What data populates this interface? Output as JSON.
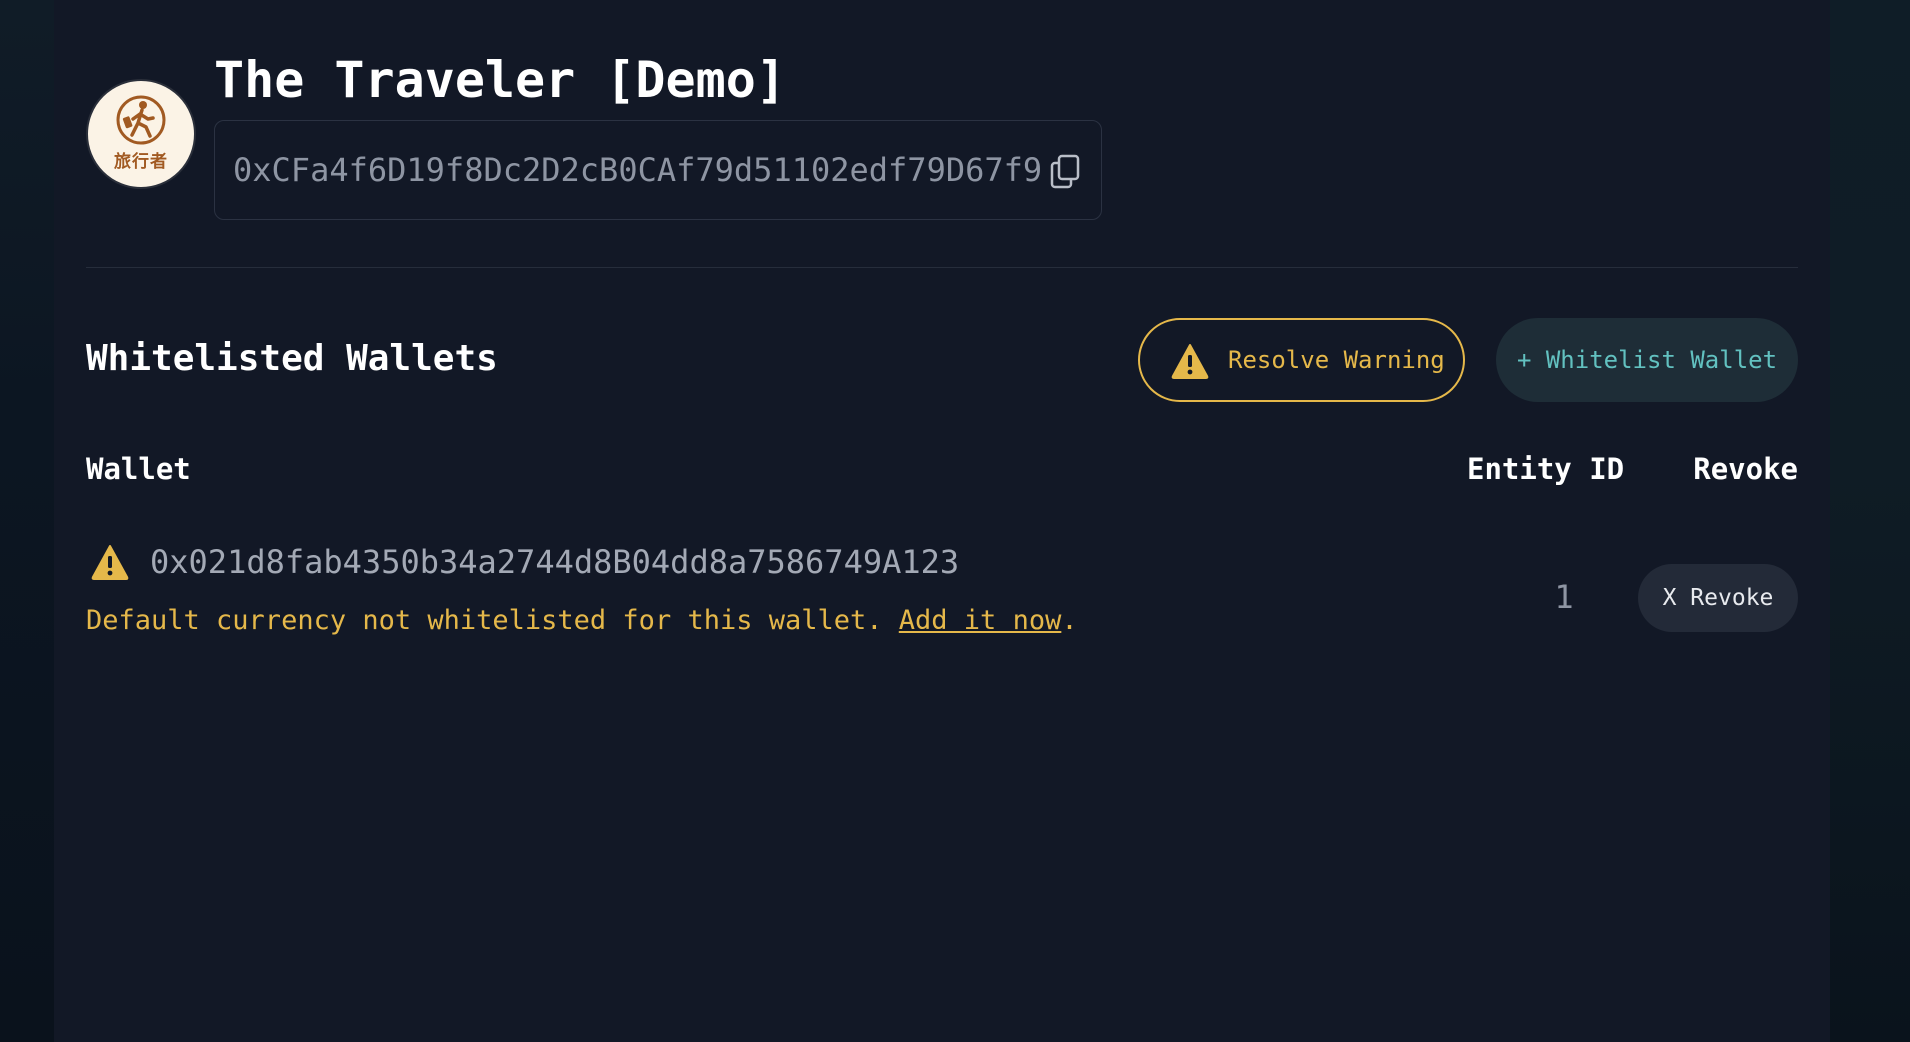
{
  "profile": {
    "avatar_icon": "walking-traveler-icon",
    "avatar_text": "旅行者",
    "title": "The Traveler [Demo]",
    "address": "0xCFa4f6D19f8Dc2D2cB0CAf79d51102edf79D67f9",
    "copy_icon": "copy-icon"
  },
  "section": {
    "title": "Whitelisted Wallets",
    "resolve_warning_label": "Resolve Warning",
    "whitelist_wallet_label": "+ Whitelist Wallet"
  },
  "table": {
    "headers": {
      "wallet": "Wallet",
      "entity_id": "Entity ID",
      "revoke": "Revoke"
    },
    "rows": [
      {
        "wallet": "0x021d8fab4350b34a2744d8B04dd8a7586749A123",
        "warning_text": "Default currency not whitelisted for this wallet. ",
        "warning_link": "Add it now",
        "warning_suffix": ".",
        "entity_id": "1",
        "revoke_label": "X Revoke"
      }
    ]
  },
  "colors": {
    "background": "#121826",
    "warning": "#e5b84a",
    "accent": "#62c1c0",
    "muted_text": "#8e95a3"
  }
}
